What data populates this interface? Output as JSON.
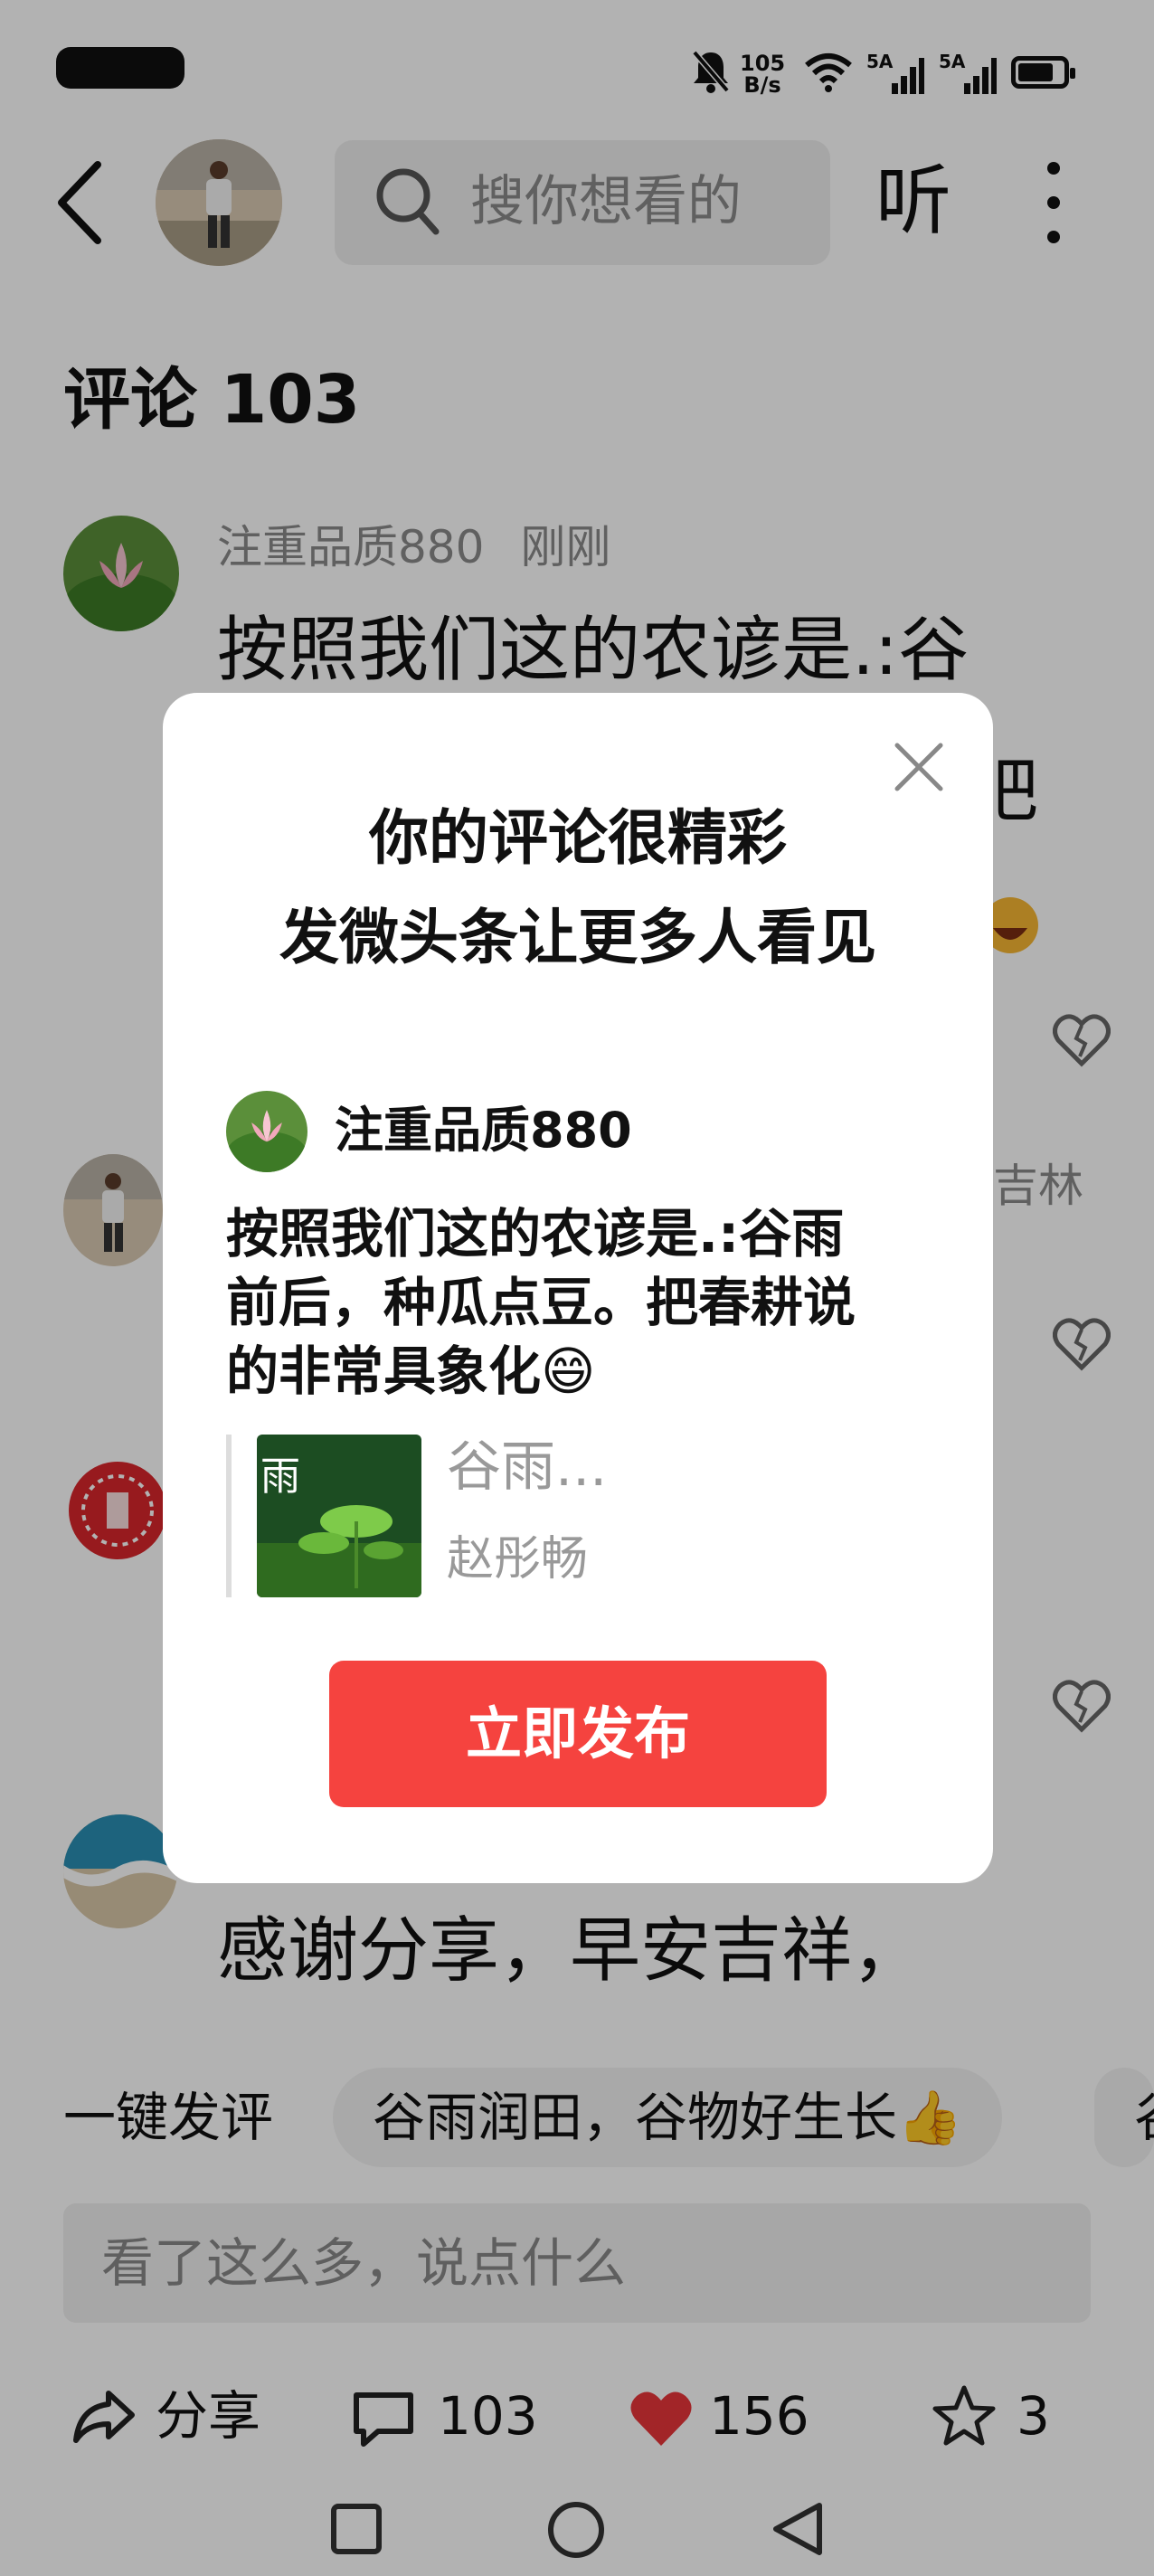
{
  "status_bar": {
    "net_speed_value": "105",
    "net_speed_unit": "B/s",
    "signal_1": "5A",
    "signal_2": "5A",
    "battery_level": 0.8
  },
  "header": {
    "search_placeholder": "搜你想看的",
    "listen_label": "听"
  },
  "comments_section": {
    "title": "评论 103",
    "comments": [
      {
        "author": "注重品质880",
        "time": "刚刚",
        "text": "按照我们这的农谚是.:谷",
        "text_line_2": "吧"
      },
      {
        "author_tail": "吉林"
      },
      {},
      {
        "text": "感谢分享，早安吉祥，"
      }
    ]
  },
  "quick_reply": {
    "label": "一键发评",
    "suggestions": [
      "谷雨润田，谷物好生长👍",
      "谷"
    ]
  },
  "comment_input": {
    "placeholder": "看了这么多，说点什么"
  },
  "bottom_actions": {
    "share_label": "分享",
    "comment_count": "103",
    "like_count": "156",
    "favorite_count": "3"
  },
  "modal": {
    "title_line_1": "你的评论很精彩",
    "title_line_2": "发微头条让更多人看见",
    "author": "注重品质880",
    "text_lines": [
      "按照我们这的农谚是.:谷雨",
      "前后，种瓜点豆。把春耕说",
      "的非常具象化😄"
    ],
    "article_title": "谷雨...",
    "article_author": "赵彤畅",
    "thumb_text": "雨",
    "publish_label": "立即发布"
  },
  "colors": {
    "accent_red": "#f5433f",
    "heart_red": "#e8363a",
    "dim_overlay": "rgba(0,0,0,0.30)"
  }
}
